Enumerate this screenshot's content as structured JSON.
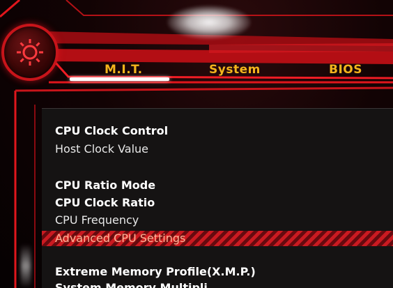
{
  "header": {
    "logo_icon": "gear-icon",
    "accent_color": "#c8141a",
    "tab_text_color": "#f3b41c"
  },
  "tabs": [
    {
      "label": "M.I.T.",
      "active": true
    },
    {
      "label": "System",
      "active": false
    },
    {
      "label": "BIOS",
      "active": false
    }
  ],
  "menu": {
    "items": [
      {
        "label": "CPU Clock Control"
      },
      {
        "label": "Host Clock Value"
      },
      {
        "label": "CPU Ratio Mode"
      },
      {
        "label": "CPU Clock Ratio"
      },
      {
        "label": "CPU Frequency"
      },
      {
        "label": "Advanced CPU Settings",
        "selected": true
      },
      {
        "label": "Extreme Memory Profile(X.M.P.)"
      },
      {
        "label": "System Memory Multipli"
      }
    ],
    "selected_color": "#d41a22"
  }
}
